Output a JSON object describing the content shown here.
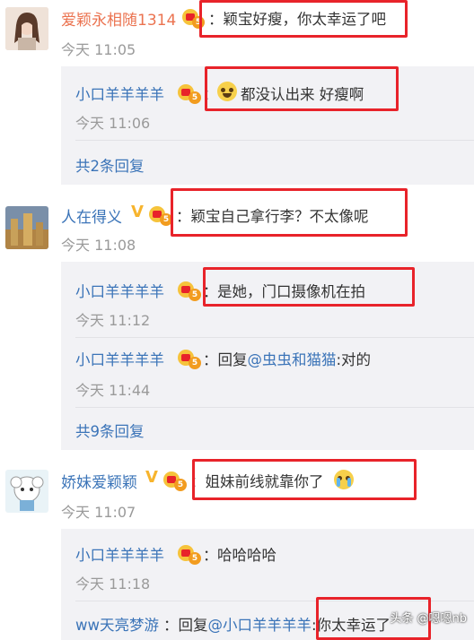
{
  "comments": [
    {
      "username": "爱颖永相随1314",
      "text": "颖宝好瘦，你太幸运了吧",
      "time": "今天 11:05",
      "replies": [
        {
          "username": "小口羊羊羊羊",
          "text": "都没认出来 好瘦啊",
          "time": "今天 11:06"
        }
      ],
      "more": "共2条回复"
    },
    {
      "username": "人在得义",
      "text": "颖宝自己拿行李？不太像呢",
      "time": "今天 11:08",
      "replies": [
        {
          "username": "小口羊羊羊羊",
          "text": "是她，门口摄像机在拍",
          "time": "今天 11:12"
        },
        {
          "username": "小口羊羊羊羊",
          "text_prefix": "回复",
          "mention": "@虫虫和猫猫",
          "text_suffix": ":对的",
          "time": "今天 11:44"
        }
      ],
      "more": "共9条回复"
    },
    {
      "username": "娇妹爱颖颖",
      "text": "姐妹前线就靠你了",
      "time": "今天 11:07",
      "replies": [
        {
          "username": "小口羊羊羊羊",
          "text": "哈哈哈哈",
          "time": "今天 11:18"
        },
        {
          "username": "ww天亮梦游",
          "text_prefix": "回复",
          "mention": "@小口羊羊羊羊",
          "text_suffix": ":你太幸运了"
        }
      ]
    }
  ],
  "badge_level": "5",
  "watermark": "头条 @嗯嗯nb",
  "colors": {
    "accent": "#eb7350",
    "link": "#3b74b8",
    "highlight": "#e8232a",
    "reply_bg": "#f2f2f5"
  }
}
